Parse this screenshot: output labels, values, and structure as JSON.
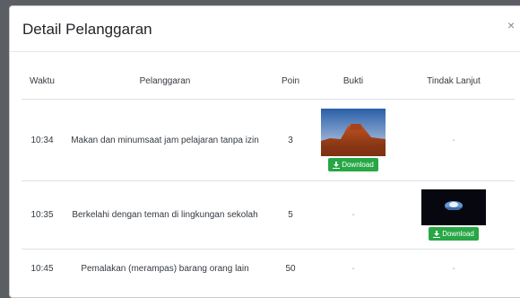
{
  "modal": {
    "title": "Detail Pelanggaran",
    "close_label": "×"
  },
  "table": {
    "headers": [
      "Waktu",
      "Pelanggaran",
      "Poin",
      "Bukti",
      "Tindak Lanjut"
    ],
    "rows": [
      {
        "time": "10:34",
        "violation": "Makan dan minumsaat jam pelajaran tanpa izin",
        "points": "3",
        "proof": "image-desert",
        "followup": "-"
      },
      {
        "time": "10:35",
        "violation": "Berkelahi dengan teman di lingkungan sekolah",
        "points": "5",
        "proof": "-",
        "followup": "image-dark"
      },
      {
        "time": "10:45",
        "violation": "Pemalakan (merampas) barang orang lain",
        "points": "50",
        "proof": "-",
        "followup": "-"
      }
    ],
    "download_label": "Download"
  },
  "colors": {
    "download_button": "#28a745",
    "overlay": "#5b5f63"
  }
}
